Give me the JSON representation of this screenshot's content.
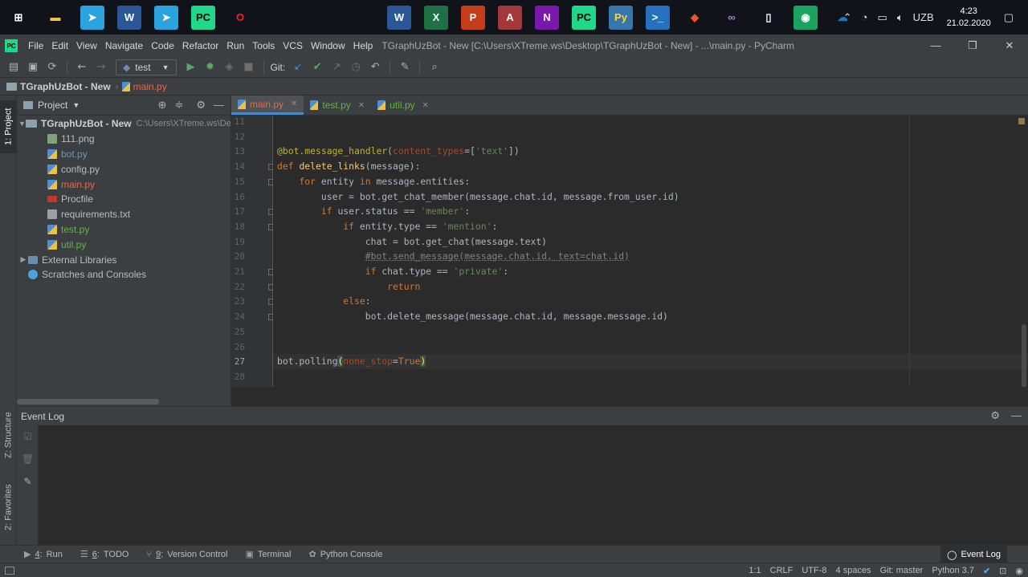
{
  "taskbar": {
    "apps": [
      {
        "name": "windows-start",
        "glyph": "⊞",
        "color": "#ffffff",
        "bg": "transparent"
      },
      {
        "name": "file-explorer",
        "glyph": "▬",
        "color": "#f4c542",
        "bg": "transparent"
      },
      {
        "name": "telegram",
        "glyph": "➤",
        "color": "#ffffff",
        "bg": "#2aa3de"
      },
      {
        "name": "word",
        "glyph": "W",
        "color": "#ffffff",
        "bg": "#2b5797"
      },
      {
        "name": "telegram-2",
        "glyph": "➤",
        "color": "#ffffff",
        "bg": "#2aa3de"
      },
      {
        "name": "pycharm",
        "glyph": "PC",
        "color": "#000000",
        "bg": "#21d789"
      },
      {
        "name": "opera",
        "glyph": "O",
        "color": "#ff1b2d",
        "bg": "transparent"
      },
      {
        "name": "word-pinned",
        "glyph": "W",
        "color": "#ffffff",
        "bg": "#2b5797"
      },
      {
        "name": "excel",
        "glyph": "X",
        "color": "#ffffff",
        "bg": "#1e7145"
      },
      {
        "name": "powerpoint",
        "glyph": "P",
        "color": "#ffffff",
        "bg": "#c43e1c"
      },
      {
        "name": "access",
        "glyph": "A",
        "color": "#ffffff",
        "bg": "#a4373a"
      },
      {
        "name": "onenote",
        "glyph": "N",
        "color": "#ffffff",
        "bg": "#7719aa"
      },
      {
        "name": "pycharm-pinned",
        "glyph": "PC",
        "color": "#000000",
        "bg": "#21d789"
      },
      {
        "name": "python",
        "glyph": "Py",
        "color": "#ffd43b",
        "bg": "#3776ab"
      },
      {
        "name": "powershell",
        "glyph": ">_",
        "color": "#ffffff",
        "bg": "#2671be"
      },
      {
        "name": "git",
        "glyph": "◆",
        "color": "#f05133",
        "bg": "transparent"
      },
      {
        "name": "visual-studio",
        "glyph": "∞",
        "color": "#b180d7",
        "bg": "transparent"
      },
      {
        "name": "notepad",
        "glyph": "▯",
        "color": "#ffffff",
        "bg": "transparent"
      },
      {
        "name": "wifi-app",
        "glyph": "◉",
        "color": "#ffffff",
        "bg": "#1aa260"
      },
      {
        "name": "onedrive",
        "glyph": "☁",
        "color": "#0f7bd8",
        "bg": "transparent"
      }
    ],
    "language": "UZB",
    "time": "4:23",
    "date": "21.02.2020"
  },
  "menubar": {
    "app_icon": "PC",
    "items": [
      "File",
      "Edit",
      "View",
      "Navigate",
      "Code",
      "Refactor",
      "Run",
      "Tools",
      "VCS",
      "Window",
      "Help"
    ],
    "title": "TGraphUzBot - New [C:\\Users\\XTreme.ws\\Desktop\\TGraphUzBot - New] - ...\\main.py - PyCharm"
  },
  "toolbar": {
    "run_config": "test",
    "git_label": "Git:"
  },
  "breadcrumb": {
    "project": "TGraphUzBot - New",
    "file": "main.py"
  },
  "left_strip": {
    "project_tab": "1: Project",
    "structure_tab": "Z: Structure",
    "favorites_tab": "2: Favorites"
  },
  "project_panel": {
    "title": "Project",
    "root": {
      "name": "TGraphUzBot - New",
      "path": "C:\\Users\\XTreme.ws\\Des"
    },
    "files": [
      {
        "name": "111.png",
        "icon": "png",
        "color": "norm"
      },
      {
        "name": "bot.py",
        "icon": "py",
        "color": "blue"
      },
      {
        "name": "config.py",
        "icon": "py",
        "color": "norm"
      },
      {
        "name": "main.py",
        "icon": "py",
        "color": "red"
      },
      {
        "name": "Procfile",
        "icon": "proc",
        "color": "norm"
      },
      {
        "name": "requirements.txt",
        "icon": "txt",
        "color": "norm"
      },
      {
        "name": "test.py",
        "icon": "py",
        "color": "green"
      },
      {
        "name": "util.py",
        "icon": "py",
        "color": "green"
      }
    ],
    "external_libraries": "External Libraries",
    "scratches": "Scratches and Consoles"
  },
  "editor": {
    "tabs": [
      {
        "label": "main.py",
        "color": "#e4694c",
        "active": true
      },
      {
        "label": "test.py",
        "color": "#62b543",
        "active": false
      },
      {
        "label": "util.py",
        "color": "#62b543",
        "active": false
      }
    ],
    "current_line": "27",
    "lines": [
      {
        "no": "11",
        "html": ""
      },
      {
        "no": "12",
        "html": ""
      },
      {
        "no": "13",
        "html": "<span class=\"deco\">@bot.message_handler</span>(<span class=\"param\">content_types</span>=[<span class=\"str\">'text'</span>])"
      },
      {
        "no": "14",
        "html": "<span class=\"kw\">def</span> <span class=\"fn\">delete_links</span>(message):"
      },
      {
        "no": "15",
        "html": "    <span class=\"kw\">for</span> entity <span class=\"kw\">in</span> message.entities:"
      },
      {
        "no": "16",
        "html": "        user = bot.get_chat_member(message.chat.id, message.from_user.id)"
      },
      {
        "no": "17",
        "html": "        <span class=\"kw\">if</span> user.status == <span class=\"str\">'member'</span>:"
      },
      {
        "no": "18",
        "html": "            <span class=\"kw\">if</span> entity.type == <span class=\"str\">'mention'</span>:"
      },
      {
        "no": "19",
        "html": "                chat = bot.get_chat(message.text)"
      },
      {
        "no": "20",
        "html": "                <span class=\"cmt\">#bot.send_message(message.chat.id, text=chat.id)</span>"
      },
      {
        "no": "21",
        "html": "                <span class=\"kw\">if</span> chat.type == <span class=\"str\">'private'</span>:"
      },
      {
        "no": "22",
        "html": "                    <span class=\"kw\">return</span>"
      },
      {
        "no": "23",
        "html": "            <span class=\"kw\">else</span>:"
      },
      {
        "no": "24",
        "html": "                bot.delete_message(message.chat.id, message.message.id)"
      },
      {
        "no": "25",
        "html": ""
      },
      {
        "no": "26",
        "html": ""
      },
      {
        "no": "27",
        "html": "bot.polling<span class=\"paren-hl\">(</span><span class=\"param\">none_stop</span>=<span class=\"kw\">True</span><span class=\"paren-hl\">)</span>"
      },
      {
        "no": "28",
        "html": ""
      }
    ]
  },
  "event_log": {
    "title": "Event Log"
  },
  "bottom_tabs": [
    {
      "num": "4",
      "label": "Run",
      "glyph": "▶"
    },
    {
      "num": "6",
      "label": "TODO",
      "glyph": "☰"
    },
    {
      "num": "9",
      "label": "Version Control",
      "glyph": "⑂"
    },
    {
      "num": "",
      "label": "Terminal",
      "glyph": "▣"
    },
    {
      "num": "",
      "label": "Python Console",
      "glyph": "✿"
    }
  ],
  "event_log_button": "Event Log",
  "status": {
    "position": "1:1",
    "line_sep": "CRLF",
    "encoding": "UTF-8",
    "indent": "4 spaces",
    "git": "Git: master",
    "interpreter": "Python 3.7"
  }
}
